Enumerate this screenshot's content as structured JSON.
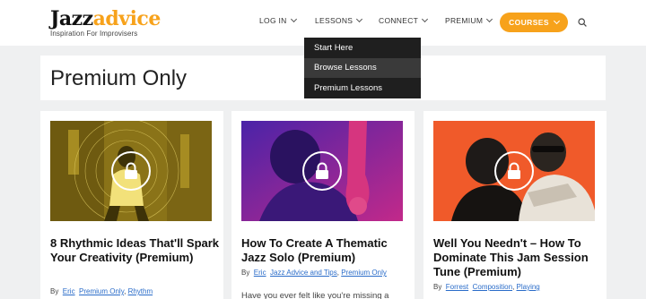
{
  "header": {
    "logo_jazz": "Jazz",
    "logo_advice": "advice",
    "tagline": "Inspiration For Improvisers",
    "nav": {
      "login": "LOG IN",
      "lessons": "LESSONS",
      "connect": "CONNECT",
      "premium": "PREMIUM",
      "courses": "COURSES"
    }
  },
  "dropdown": {
    "items": [
      "Start Here",
      "Browse Lessons",
      "Premium Lessons"
    ]
  },
  "page": {
    "title": "Premium Only"
  },
  "cards": [
    {
      "title": "8 Rhythmic Ideas That'll Spark Your Creativity (Premium)",
      "by": "By",
      "author": "Eric",
      "categories": [
        "Premium Only",
        "Rhythm"
      ]
    },
    {
      "title": "How To Create A Thematic Jazz Solo (Premium)",
      "by": "By",
      "author": "Eric",
      "categories": [
        "Jazz Advice and Tips",
        "Premium Only"
      ],
      "excerpt": "Have you ever felt like you're missing a"
    },
    {
      "title": "Well You Needn't – How To Dominate This Jam Session Tune (Premium)",
      "by": "By",
      "author": "Forrest",
      "categories": [
        "Composition",
        "Playing"
      ]
    }
  ],
  "colors": {
    "accent": "#f7a21b",
    "link": "#2a6cc9",
    "dropdown_bg": "#1f1f1f"
  }
}
